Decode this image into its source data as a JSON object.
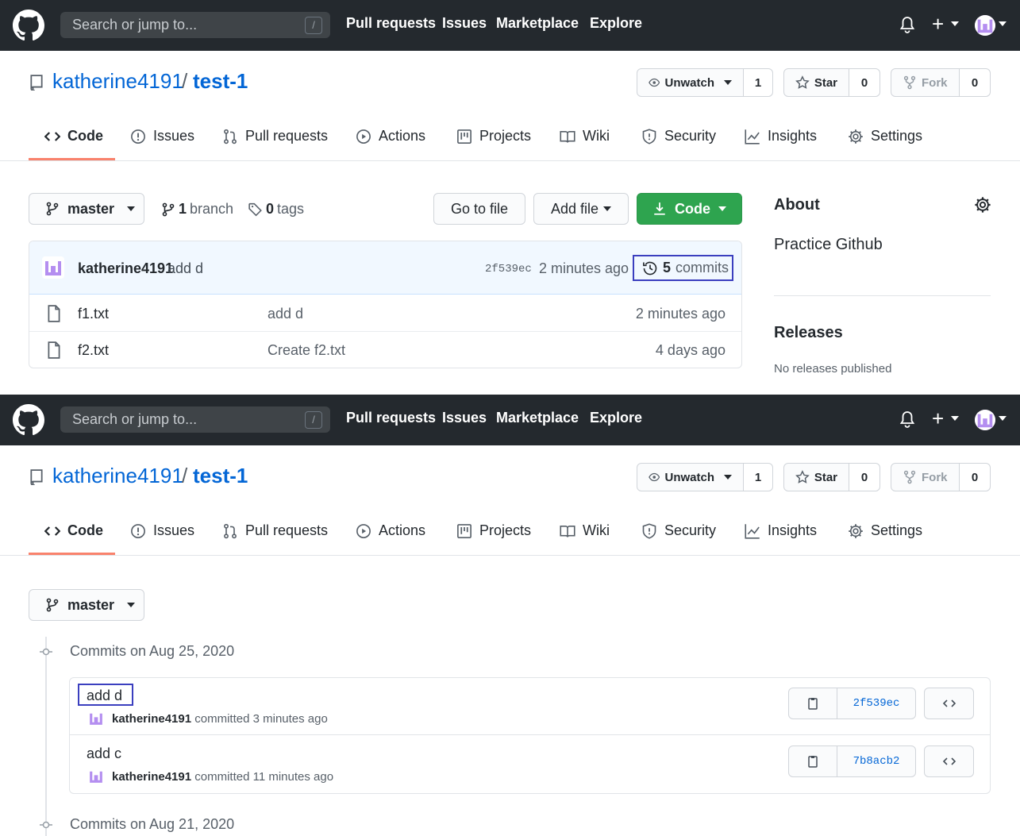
{
  "header": {
    "search_placeholder": "Search or jump to...",
    "search_shortcut": "/",
    "nav": [
      "Pull requests",
      "Issues",
      "Marketplace",
      "Explore"
    ]
  },
  "repo": {
    "owner": "katherine4191",
    "separator": "/",
    "name": "test-1",
    "watch_label": "Unwatch",
    "watch_count": "1",
    "star_label": "Star",
    "star_count": "0",
    "fork_label": "Fork",
    "fork_count": "0"
  },
  "tabs": [
    "Code",
    "Issues",
    "Pull requests",
    "Actions",
    "Projects",
    "Wiki",
    "Security",
    "Insights",
    "Settings"
  ],
  "code_view": {
    "branch": "master",
    "branch_count": "1",
    "branch_label": "branch",
    "tag_count": "0",
    "tag_label": "tags",
    "go_to_file": "Go to file",
    "add_file": "Add file",
    "code_button": "Code",
    "latest_commit": {
      "author": "katherine4191",
      "message": "add d",
      "sha": "2f539ec",
      "age": "2 minutes ago",
      "commits_count": "5",
      "commits_label": "commits"
    },
    "files": [
      {
        "name": "f1.txt",
        "message": "add d",
        "age": "2 minutes ago"
      },
      {
        "name": "f2.txt",
        "message": "Create f2.txt",
        "age": "4 days ago"
      }
    ],
    "about": {
      "title": "About",
      "description": "Practice Github",
      "releases_title": "Releases",
      "releases_text": "No releases published"
    }
  },
  "commits_view": {
    "branch": "master",
    "groups": [
      {
        "heading": "Commits on Aug 25, 2020",
        "commits": [
          {
            "title": "add d",
            "author": "katherine4191",
            "verb": "committed",
            "age": "3 minutes ago",
            "sha": "2f539ec"
          },
          {
            "title": "add c",
            "author": "katherine4191",
            "verb": "committed",
            "age": "11 minutes ago",
            "sha": "7b8acb2"
          }
        ]
      },
      {
        "heading": "Commits on Aug 21, 2020",
        "commits": []
      }
    ]
  },
  "colors": {
    "header_bg": "#24292e",
    "link": "#0366d6",
    "green_button": "#2ea44f",
    "tab_underline": "#f9826c",
    "highlight_box": "#3b3fbf",
    "avatar": "#b48ef0"
  }
}
